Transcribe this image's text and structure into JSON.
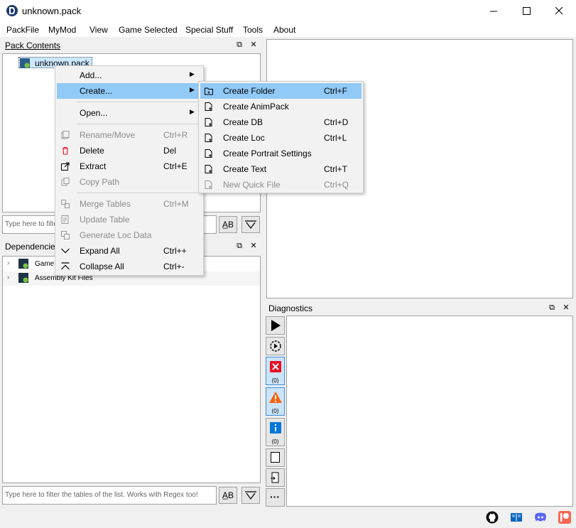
{
  "window": {
    "title": "unknown.pack"
  },
  "menubar": [
    "PackFile",
    "MyMod",
    "View",
    "Game Selected",
    "Special Stuff",
    "Tools",
    "About"
  ],
  "pack_contents": {
    "title": "Pack Contents",
    "root_item": "unknown.pack",
    "filter_placeholder": "Type here to filter"
  },
  "dependencies": {
    "title": "Dependencies",
    "items": [
      "Game",
      "Assembly Kit Files"
    ],
    "filter_placeholder": "Type here to filter the tables of the list. Works with Regex too!"
  },
  "diagnostics": {
    "title": "Diagnostics",
    "error_count": "(0)",
    "warning_count": "(0)",
    "info_count": "(0)"
  },
  "context_menu": {
    "items": [
      {
        "label": "Add...",
        "shortcut": "",
        "submenu": true,
        "disabled": false,
        "icon": "none"
      },
      {
        "label": "Create...",
        "shortcut": "",
        "submenu": true,
        "disabled": false,
        "icon": "none",
        "highlighted": true
      },
      {
        "label": "Open...",
        "shortcut": "",
        "submenu": true,
        "disabled": false,
        "icon": "none"
      },
      {
        "label": "Rename/Move",
        "shortcut": "Ctrl+R",
        "disabled": true,
        "icon": "rename-icon"
      },
      {
        "label": "Delete",
        "shortcut": "Del",
        "disabled": false,
        "icon": "trash-icon"
      },
      {
        "label": "Extract",
        "shortcut": "Ctrl+E",
        "disabled": false,
        "icon": "extract-icon"
      },
      {
        "label": "Copy Path",
        "shortcut": "",
        "disabled": true,
        "icon": "copy-icon"
      },
      {
        "label": "Merge Tables",
        "shortcut": "Ctrl+M",
        "disabled": true,
        "icon": "merge-icon"
      },
      {
        "label": "Update Table",
        "shortcut": "",
        "disabled": true,
        "icon": "update-icon"
      },
      {
        "label": "Generate Loc Data",
        "shortcut": "",
        "disabled": true,
        "icon": "loc-icon"
      },
      {
        "label": "Expand All",
        "shortcut": "Ctrl++",
        "disabled": false,
        "icon": "expand-icon"
      },
      {
        "label": "Collapse All",
        "shortcut": "Ctrl+-",
        "disabled": false,
        "icon": "collapse-icon"
      }
    ]
  },
  "submenu": {
    "items": [
      {
        "label": "Create Folder",
        "shortcut": "Ctrl+F",
        "disabled": false,
        "highlighted": true
      },
      {
        "label": "Create AnimPack",
        "shortcut": "",
        "disabled": false
      },
      {
        "label": "Create DB",
        "shortcut": "Ctrl+D",
        "disabled": false
      },
      {
        "label": "Create Loc",
        "shortcut": "Ctrl+L",
        "disabled": false
      },
      {
        "label": "Create Portrait Settings",
        "shortcut": "",
        "disabled": false
      },
      {
        "label": "Create Text",
        "shortcut": "Ctrl+T",
        "disabled": false
      },
      {
        "label": "New Quick File",
        "shortcut": "Ctrl+Q",
        "disabled": true
      }
    ]
  },
  "colors": {
    "highlight": "#91c9f7",
    "error_red": "#e81123",
    "warning_orange": "#f7630c",
    "info_blue": "#0078d7",
    "patreon": "#f96854",
    "discord": "#5865f2"
  }
}
